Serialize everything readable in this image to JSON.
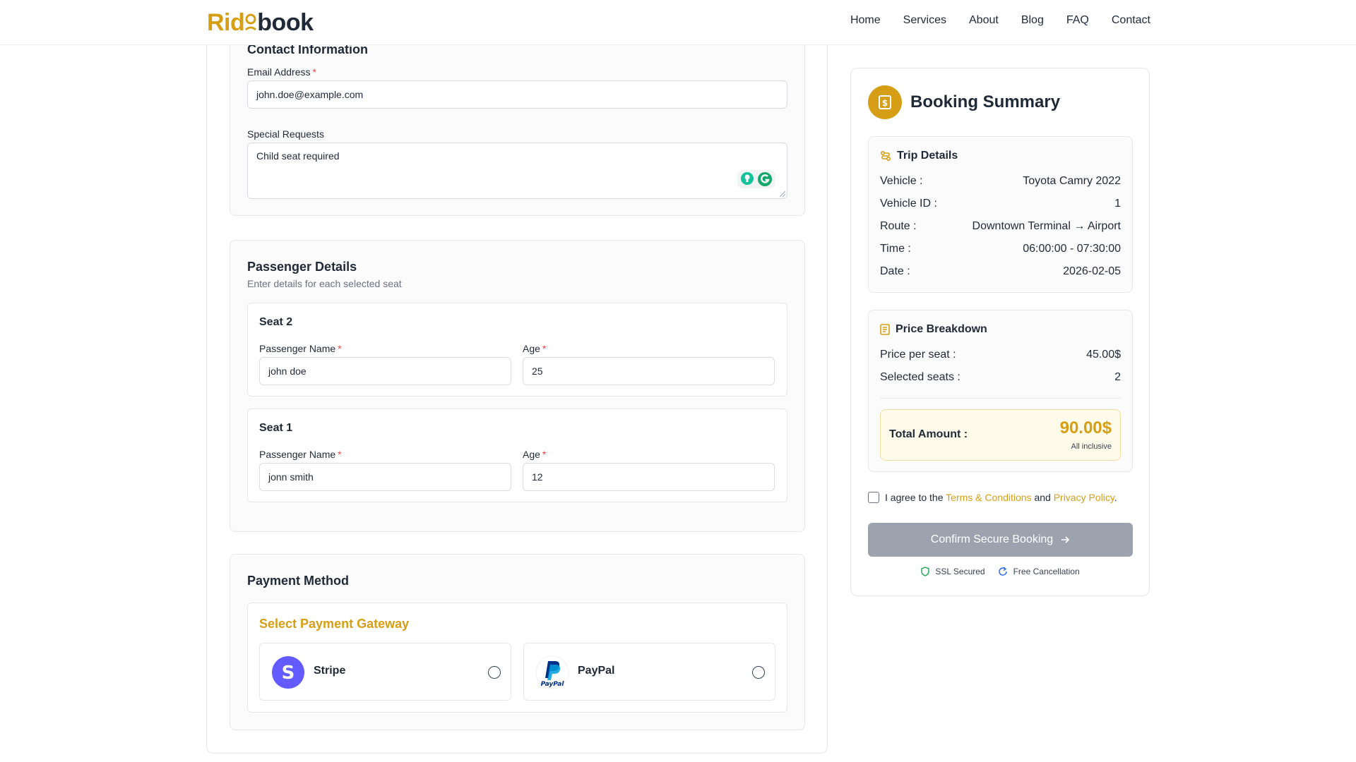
{
  "brand": {
    "part1": "Rid",
    "part2": "book"
  },
  "nav": [
    "Home",
    "Services",
    "About",
    "Blog",
    "FAQ",
    "Contact"
  ],
  "contact": {
    "section_title": "Contact Information",
    "email_label": "Email Address",
    "email_value": "john.doe@example.com",
    "requests_label": "Special Requests",
    "requests_value": "Child seat required"
  },
  "passengers": {
    "title": "Passenger Details",
    "subtitle": "Enter details for each selected seat",
    "name_label": "Passenger Name",
    "age_label": "Age",
    "seats": [
      {
        "seat": "Seat 2",
        "name": "john doe",
        "age": "25"
      },
      {
        "seat": "Seat 1",
        "name": "jonn smith",
        "age": "12"
      }
    ]
  },
  "payment": {
    "title": "Payment Method",
    "gateway_title": "Select Payment Gateway",
    "options": [
      {
        "name": "Stripe",
        "icon": "stripe-logo-icon"
      },
      {
        "name": "PayPal",
        "icon": "paypal-logo-icon"
      }
    ]
  },
  "summary": {
    "title": "Booking Summary",
    "trip": {
      "title": "Trip Details",
      "rows": [
        {
          "key": "Vehicle :",
          "value": "Toyota Camry 2022"
        },
        {
          "key": "Vehicle ID :",
          "value": "1"
        },
        {
          "key": "Route :",
          "value": "Downtown Terminal → Airport"
        },
        {
          "key": "Time :",
          "value": "06:00:00 - 07:30:00"
        },
        {
          "key": "Date :",
          "value": "2026-02-05"
        }
      ]
    },
    "price": {
      "title": "Price Breakdown",
      "rows": [
        {
          "key": "Price per seat :",
          "value": "45.00$"
        },
        {
          "key": "Selected seats :",
          "value": "2"
        }
      ],
      "total_label": "Total Amount :",
      "total_value": "90.00$",
      "total_note": "All inclusive"
    },
    "agree": {
      "prefix": "I agree to the",
      "terms": "Terms & Conditions",
      "and": "and",
      "privacy": "Privacy Policy",
      "suffix": "."
    },
    "confirm_label": "Confirm Secure Booking",
    "badges": [
      "SSL Secured",
      "Free Cancellation"
    ]
  },
  "colors": {
    "accent": "#d69e14",
    "stripe": "#635bff",
    "paypal_dark": "#003087",
    "paypal_light": "#009cde",
    "button_disabled": "#9ca3af"
  }
}
